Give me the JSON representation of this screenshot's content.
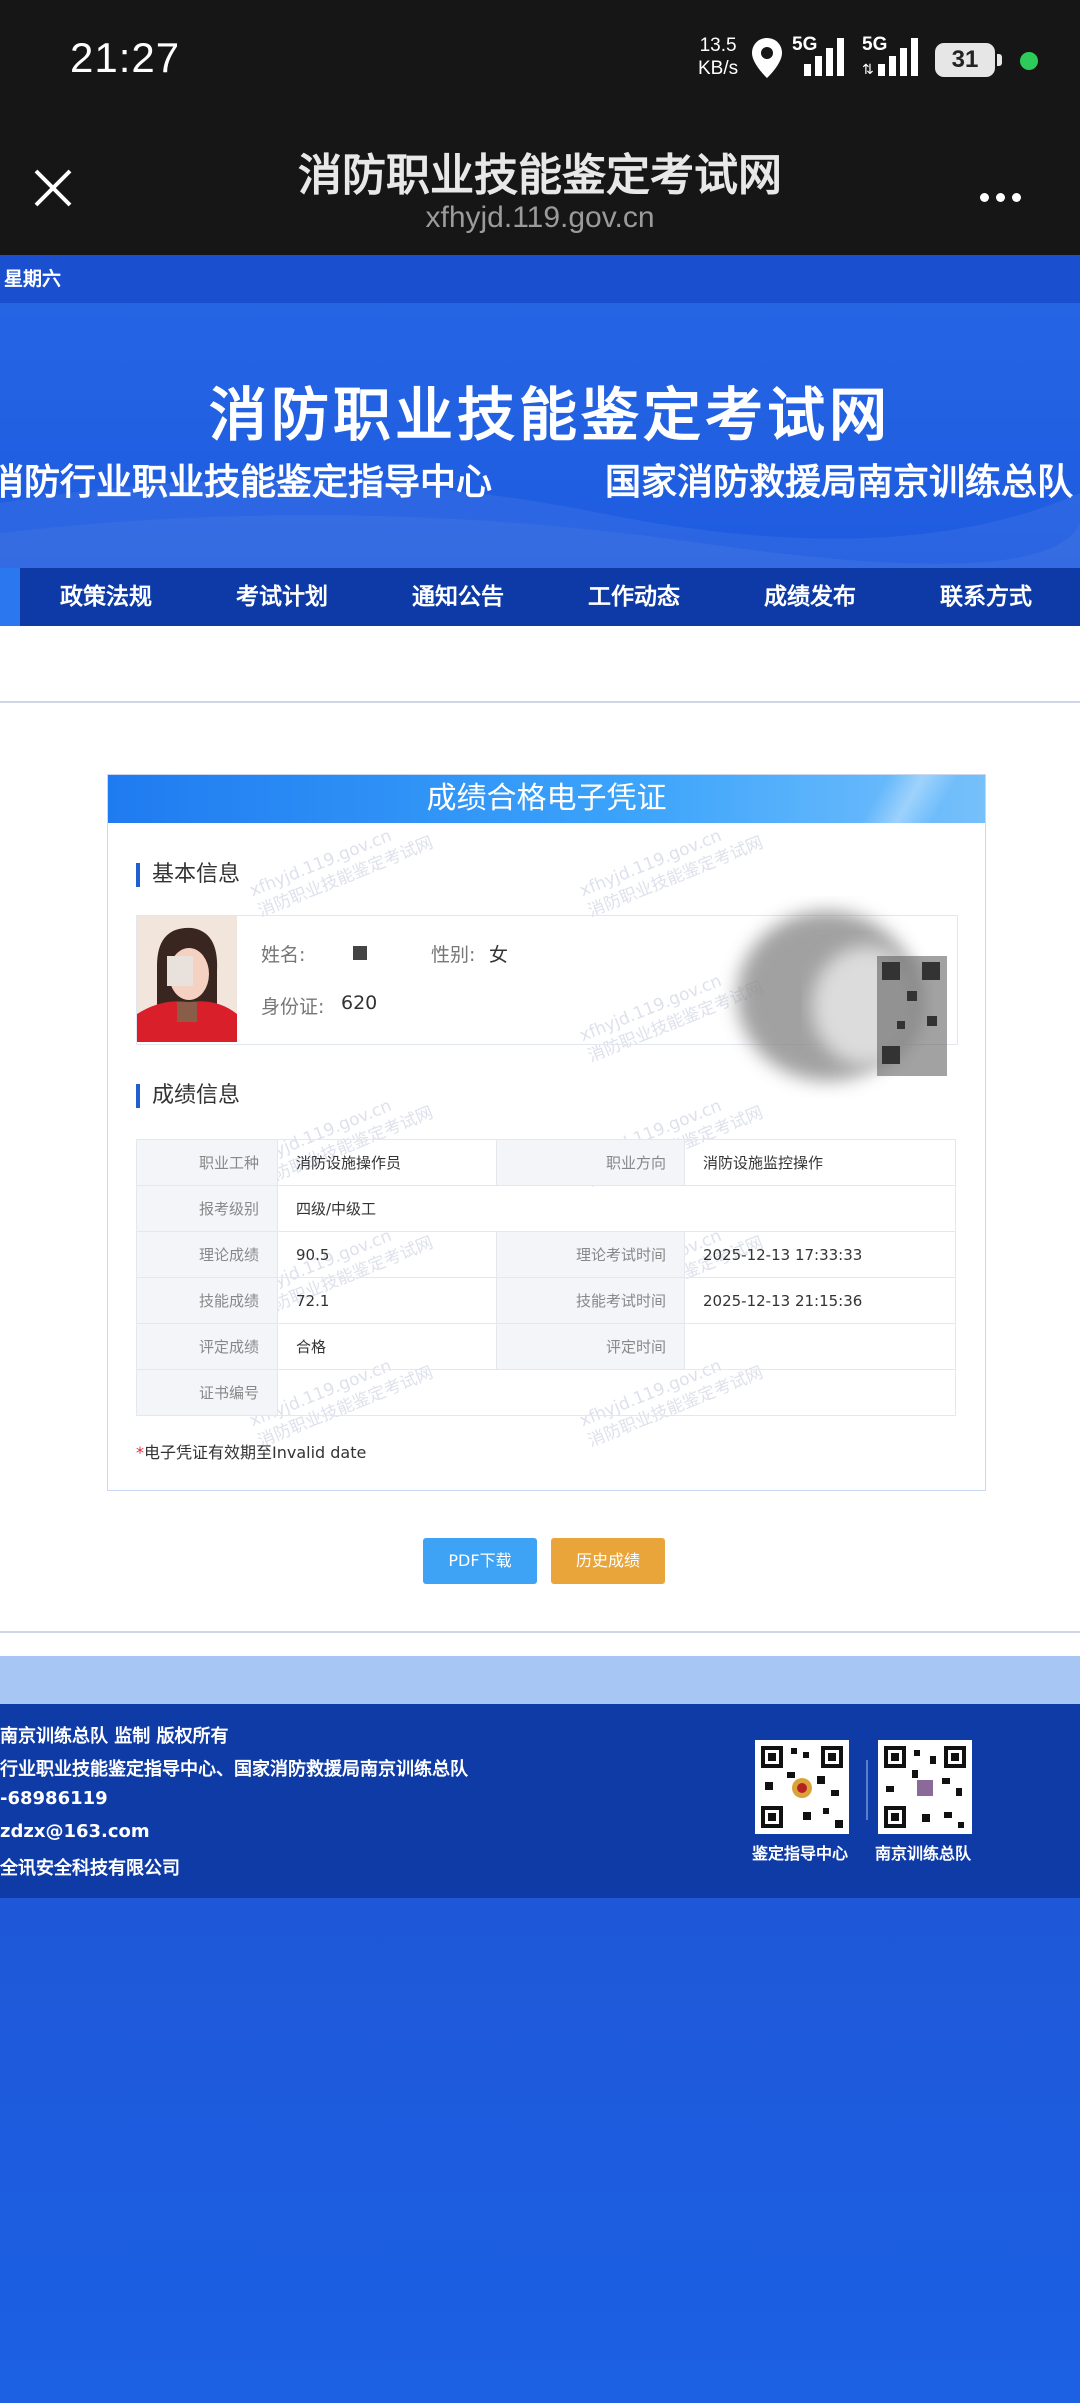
{
  "status_bar": {
    "time": "21:27",
    "net_speed_value": "13.5",
    "net_speed_unit": "KB/s",
    "signal1_label": "5G",
    "signal2_label": "5G",
    "battery": "31"
  },
  "browser": {
    "title": "消防职业技能鉴定考试网",
    "url": "xfhyjd.119.gov.cn"
  },
  "site": {
    "date_text": "星期六",
    "banner_title": "消防职业技能鉴定考试网",
    "banner_sub_left": "消防行业职业技能鉴定指导中心",
    "banner_sub_right": "国家消防救援局南京训练总队",
    "nav": [
      "政策法规",
      "考试计划",
      "通知公告",
      "工作动态",
      "成绩发布",
      "联系方式"
    ]
  },
  "certificate": {
    "header": "成绩合格电子凭证",
    "basic_title": "基本信息",
    "name_label": "姓名:",
    "gender_label": "性别:",
    "gender_value": "女",
    "id_label": "身份证:",
    "id_value": "620",
    "score_title": "成绩信息",
    "rows": {
      "occupation_label": "职业工种",
      "occupation_value": "消防设施操作员",
      "direction_label": "职业方向",
      "direction_value": "消防设施监控操作",
      "level_label": "报考级别",
      "level_value": "四级/中级工",
      "theory_label": "理论成绩",
      "theory_value": "90.5",
      "theory_time_label": "理论考试时间",
      "theory_time_value": "2025-12-13 17:33:33",
      "skill_label": "技能成绩",
      "skill_value": "72.1",
      "skill_time_label": "技能考试时间",
      "skill_time_value": "2025-12-13 21:15:36",
      "eval_label": "评定成绩",
      "eval_value": "合格",
      "eval_time_label": "评定时间",
      "eval_time_value": "",
      "cert_label": "证书编号",
      "cert_value": ""
    },
    "note_star": "*",
    "note_text": "电子凭证有效期至Invalid date",
    "watermark_url": "xfhyjd.119.gov.cn",
    "watermark_text": "消防职业技能鉴定考试网"
  },
  "buttons": {
    "pdf": "PDF下载",
    "history": "历史成绩"
  },
  "footer": {
    "lines": [
      "南京训练总队 监制 版权所有",
      "行业职业技能鉴定指导中心、国家消防救援局南京训练总队",
      "-68986119",
      "zdzx@163.com",
      "全讯安全科技有限公司"
    ],
    "qr1_label": "鉴定指导中心",
    "qr2_label": "南京训练总队"
  }
}
